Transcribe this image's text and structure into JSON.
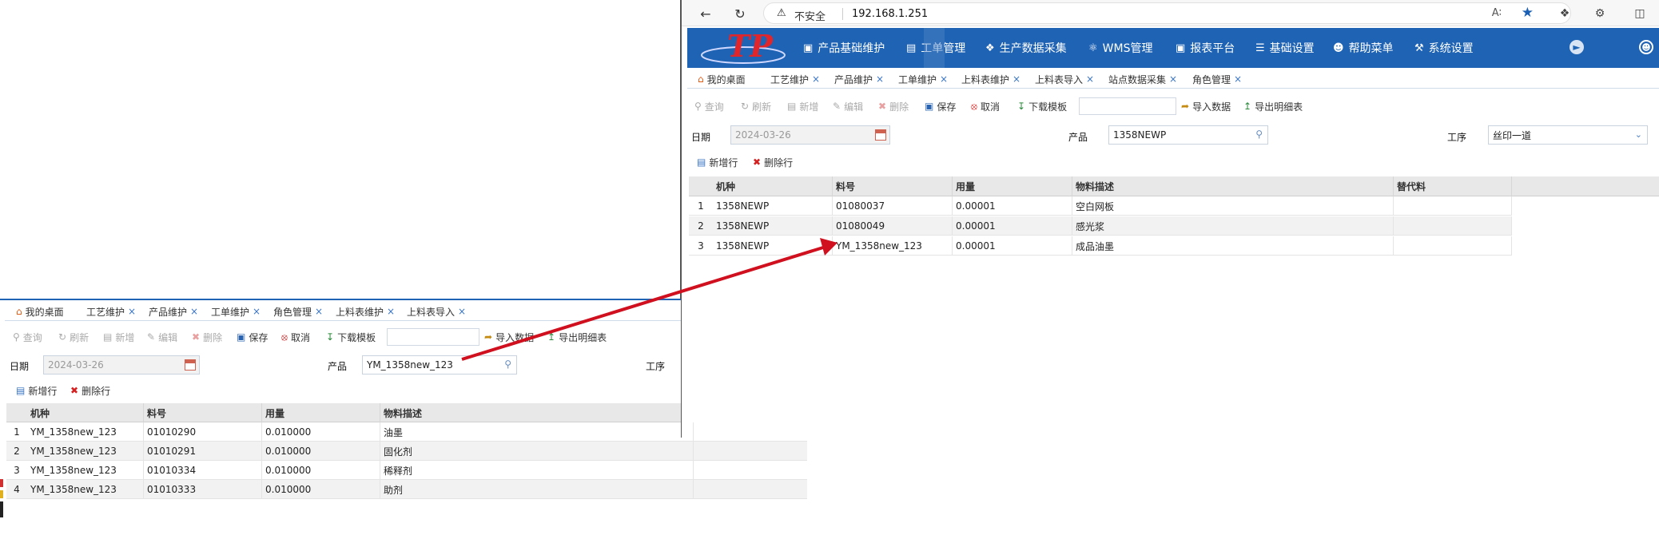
{
  "browser": {
    "security_label": "不安全",
    "url": "192.168.1.251"
  },
  "app": {
    "menu": [
      {
        "icon": "cube-icon",
        "label": "产品基础维护"
      },
      {
        "icon": "clipboard-icon",
        "label": "工单管理"
      },
      {
        "icon": "cubes-icon",
        "label": "生产数据采集"
      },
      {
        "icon": "warehouse-icon",
        "label": "WMS管理"
      },
      {
        "icon": "report-icon",
        "label": "报表平台"
      },
      {
        "icon": "database-icon",
        "label": "基础设置"
      },
      {
        "icon": "user-help-icon",
        "label": "帮助菜单"
      },
      {
        "icon": "wrench-icon",
        "label": "系统设置"
      }
    ]
  },
  "right_panel": {
    "tabs": [
      "我的桌面",
      "工艺维护",
      "产品维护",
      "工单维护",
      "上料表维护",
      "上料表导入",
      "站点数据采集",
      "角色管理"
    ],
    "toolbar": {
      "query": "查询",
      "refresh": "刷新",
      "add": "新增",
      "edit": "编辑",
      "delete": "删除",
      "save": "保存",
      "cancel": "取消",
      "download_template": "下载模板",
      "import_data": "导入数据",
      "export_detail": "导出明细表"
    },
    "form": {
      "date_label": "日期",
      "date_value": "2024-03-26",
      "product_label": "产品",
      "product_value": "1358NEWP",
      "process_label": "工序",
      "process_value": "丝印一道"
    },
    "row_actions": {
      "add_row": "新增行",
      "delete_row": "删除行"
    },
    "columns": [
      "机种",
      "料号",
      "用量",
      "物料描述",
      "替代料"
    ],
    "rows": [
      {
        "no": "1",
        "model": "1358NEWP",
        "part": "01080037",
        "qty": "0.00001",
        "desc": "空白网板",
        "alt": ""
      },
      {
        "no": "2",
        "model": "1358NEWP",
        "part": "01080049",
        "qty": "0.00001",
        "desc": "感光浆",
        "alt": ""
      },
      {
        "no": "3",
        "model": "1358NEWP",
        "part": "YM_1358new_123",
        "qty": "0.00001",
        "desc": "成品油墨",
        "alt": ""
      }
    ]
  },
  "left_panel": {
    "tabs": [
      "我的桌面",
      "工艺维护",
      "产品维护",
      "工单维护",
      "角色管理",
      "上料表维护",
      "上料表导入"
    ],
    "toolbar": {
      "query": "查询",
      "refresh": "刷新",
      "add": "新增",
      "edit": "编辑",
      "delete": "删除",
      "save": "保存",
      "cancel": "取消",
      "download_template": "下载模板",
      "import_data": "导入数据",
      "export_detail": "导出明细表"
    },
    "form": {
      "date_label": "日期",
      "date_value": "2024-03-26",
      "product_label": "产品",
      "product_value": "YM_1358new_123",
      "process_label": "工序"
    },
    "row_actions": {
      "add_row": "新增行",
      "delete_row": "删除行"
    },
    "columns": [
      "机种",
      "料号",
      "用量",
      "物料描述"
    ],
    "rows": [
      {
        "no": "1",
        "model": "YM_1358new_123",
        "part": "01010290",
        "qty": "0.010000",
        "desc": "油墨"
      },
      {
        "no": "2",
        "model": "YM_1358new_123",
        "part": "01010291",
        "qty": "0.010000",
        "desc": "固化剂"
      },
      {
        "no": "3",
        "model": "YM_1358new_123",
        "part": "01010334",
        "qty": "0.010000",
        "desc": "稀释剂"
      },
      {
        "no": "4",
        "model": "YM_1358new_123",
        "part": "01010333",
        "qty": "0.010000",
        "desc": "助剂"
      }
    ]
  },
  "colors": {
    "header_blue": "#1f63b4",
    "arrow_red": "#d0101e"
  }
}
